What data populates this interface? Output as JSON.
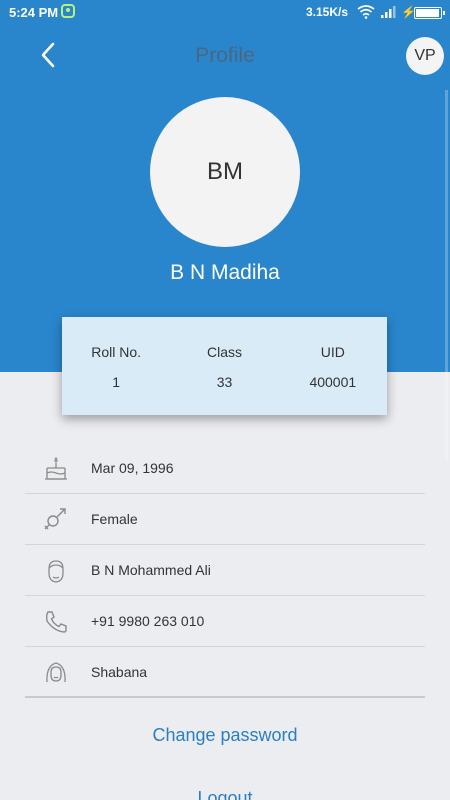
{
  "status_bar": {
    "time": "5:24 PM",
    "network_speed": "3.15K/s",
    "battery_level": 0.95
  },
  "header": {
    "title": "Profile",
    "user_initials": "VP",
    "back_icon": "chevron-left-icon"
  },
  "profile": {
    "initials": "BM",
    "name": "B N Madiha"
  },
  "info_card": {
    "roll_label": "Roll No.",
    "roll_value": "1",
    "class_label": "Class",
    "class_value": "33",
    "uid_label": "UID",
    "uid_value": "400001"
  },
  "details": [
    {
      "icon": "birthday-cake-icon",
      "value": "Mar 09, 1996"
    },
    {
      "icon": "gender-icon",
      "value": "Female"
    },
    {
      "icon": "father-icon",
      "value": "B N Mohammed Ali"
    },
    {
      "icon": "phone-icon",
      "value": "+91 9980 263 010"
    },
    {
      "icon": "mother-icon",
      "value": "Shabana"
    }
  ],
  "actions": {
    "change_password": "Change password",
    "logout": "Logout"
  },
  "colors": {
    "primary": "#2a86cc",
    "background": "#ecedf0",
    "card": "#d9ebf7",
    "link": "#2a7fc1"
  }
}
